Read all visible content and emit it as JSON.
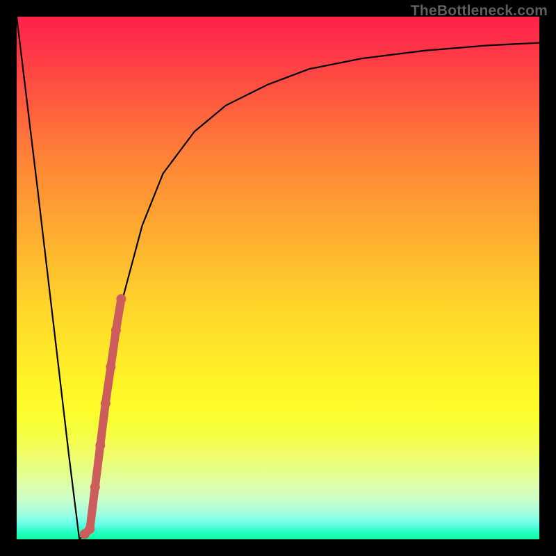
{
  "watermark": "TheBottleneck.com",
  "colors": {
    "frame": "#000000",
    "curve": "#000000",
    "highlight": "#cd5c5c",
    "gradient_top": "#ff1f4c",
    "gradient_bottom": "#0dfca0"
  },
  "chart_data": {
    "type": "line",
    "title": "",
    "xlabel": "",
    "ylabel": "",
    "xlim": [
      0,
      100
    ],
    "ylim": [
      0,
      100
    ],
    "x": [
      0,
      4,
      8,
      10,
      12,
      14,
      16,
      18,
      20,
      24,
      28,
      34,
      40,
      48,
      56,
      66,
      78,
      90,
      100
    ],
    "y": [
      100,
      67,
      33,
      16,
      0,
      2,
      18,
      33,
      45,
      60,
      70,
      78,
      83,
      87,
      90,
      92,
      93.5,
      94.5,
      95
    ],
    "highlight_segment": {
      "x": [
        13,
        14,
        15,
        16,
        17,
        18,
        19,
        20
      ],
      "y": [
        1,
        2,
        10,
        18,
        26,
        33,
        40,
        46
      ]
    },
    "note": "Values are visual estimates; axes have no ticks so domain normalised 0–100."
  }
}
